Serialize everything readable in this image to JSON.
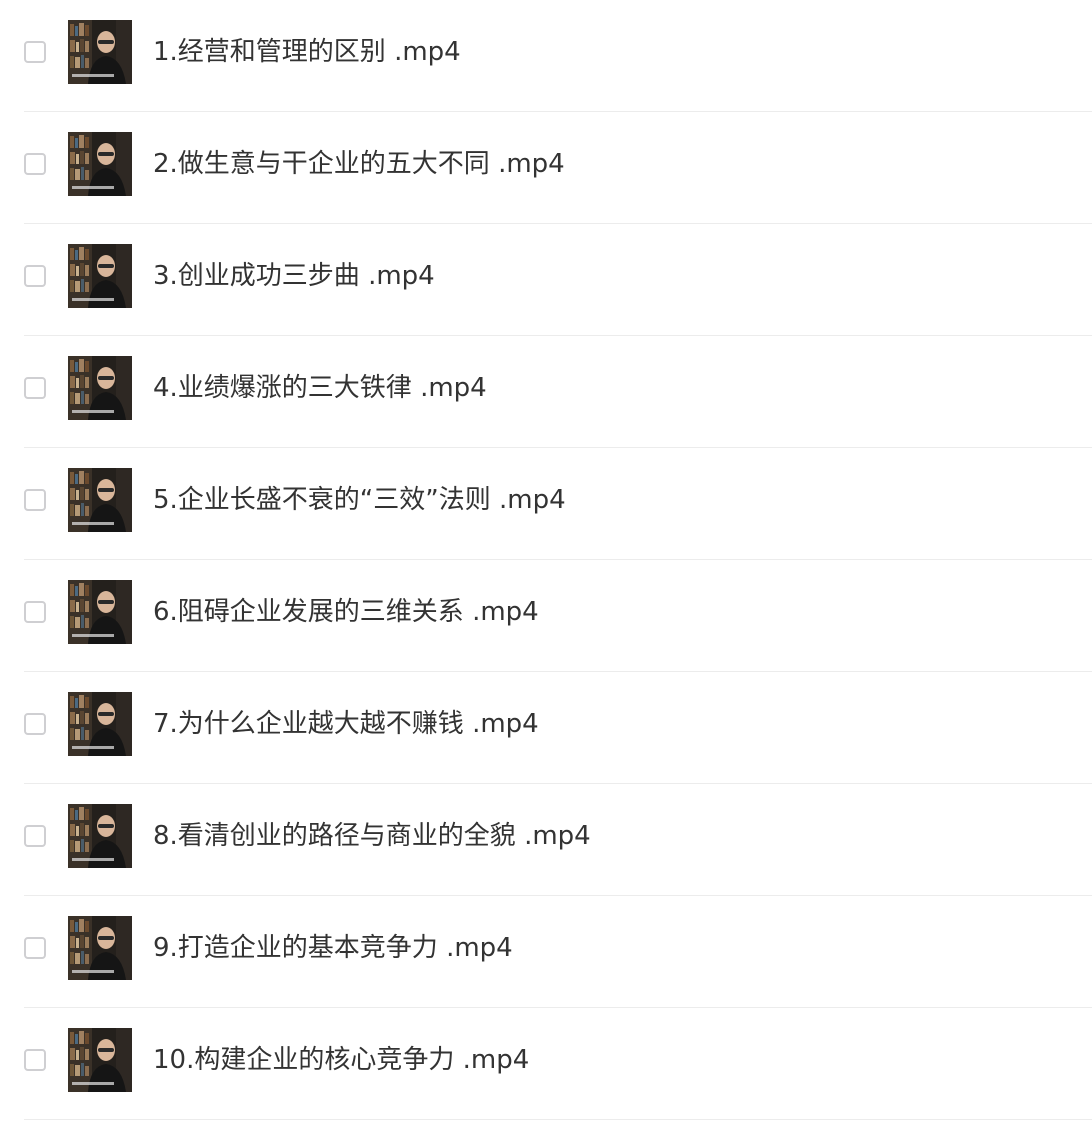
{
  "files": [
    {
      "name": "1.经营和管理的区别 .mp4",
      "icon": "video-thumbnail-icon"
    },
    {
      "name": "2.做生意与干企业的五大不同 .mp4",
      "icon": "video-thumbnail-icon"
    },
    {
      "name": "3.创业成功三步曲 .mp4",
      "icon": "video-thumbnail-icon"
    },
    {
      "name": "4.业绩爆涨的三大铁律 .mp4",
      "icon": "video-thumbnail-icon"
    },
    {
      "name": "5.企业长盛不衰的“三效”法则 .mp4",
      "icon": "video-thumbnail-icon"
    },
    {
      "name": "6.阻碍企业发展的三维关系 .mp4",
      "icon": "video-thumbnail-icon"
    },
    {
      "name": "7.为什么企业越大越不赚钱 .mp4",
      "icon": "video-thumbnail-icon"
    },
    {
      "name": "8.看清创业的路径与商业的全貌 .mp4",
      "icon": "video-thumbnail-icon"
    },
    {
      "name": "9.打造企业的基本竞争力 .mp4",
      "icon": "video-thumbnail-icon"
    },
    {
      "name": "10.构建企业的核心竞争力 .mp4",
      "icon": "video-thumbnail-icon"
    }
  ],
  "colors": {
    "text": "#333333",
    "divider": "#ececec",
    "checkbox_border": "#cfcfd2",
    "background": "#ffffff"
  }
}
